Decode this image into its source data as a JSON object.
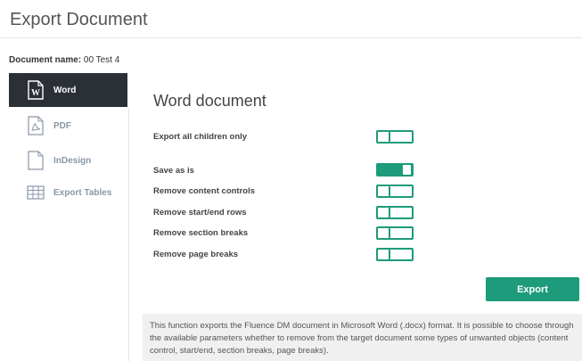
{
  "header": {
    "title": "Export Document"
  },
  "document": {
    "name_label": "Document name:",
    "name_value": "00 Test 4"
  },
  "sidebar": {
    "items": [
      {
        "label": "Word",
        "icon": "word-icon",
        "active": true
      },
      {
        "label": "PDF",
        "icon": "pdf-icon",
        "active": false
      },
      {
        "label": "InDesign",
        "icon": "file-icon",
        "active": false
      },
      {
        "label": "Export Tables",
        "icon": "table-icon",
        "active": false
      }
    ]
  },
  "panel": {
    "title": "Word document",
    "options": [
      {
        "label": "Export all children only",
        "on": false
      },
      {
        "label": "Save as is",
        "on": true
      },
      {
        "label": "Remove content controls",
        "on": false
      },
      {
        "label": "Remove start/end rows",
        "on": false
      },
      {
        "label": "Remove section breaks",
        "on": false
      },
      {
        "label": "Remove page breaks",
        "on": false
      }
    ],
    "export_label": "Export",
    "info": "This function exports the Fluence DM document in Microsoft Word (.docx) format. It is possible to choose through the available parameters whether to remove from the target document some types of unwanted objects (content control, start/end, section breaks, page breaks)."
  },
  "colors": {
    "accent": "#1e9b7a",
    "sidebar_active": "#2b2f36",
    "sidebar_text": "#8a97a8"
  }
}
